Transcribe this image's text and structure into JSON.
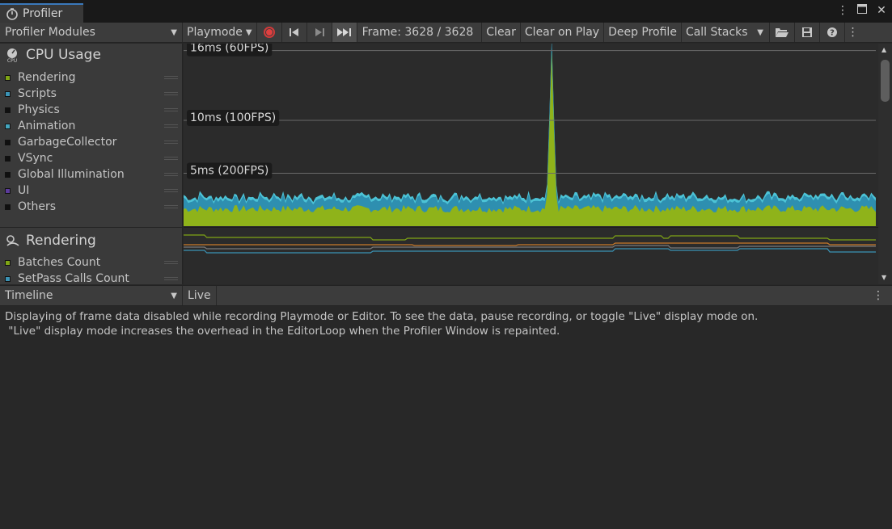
{
  "window": {
    "tab_title": "Profiler",
    "icons": [
      "kebab-menu-icon",
      "maximize-icon",
      "close-icon"
    ]
  },
  "toolbar": {
    "modules_label": "Profiler Modules",
    "target_label": "Playmode",
    "frame_text": "Frame: 3628 / 3628",
    "clear_label": "Clear",
    "clear_on_play_label": "Clear on Play",
    "deep_profile_label": "Deep Profile",
    "call_stacks_label": "Call Stacks",
    "record_color": "#e04040"
  },
  "cpu_module": {
    "title": "CPU Usage",
    "legend": [
      {
        "label": "Rendering",
        "color": "#7fa515"
      },
      {
        "label": "Scripts",
        "color": "#3b93b5"
      },
      {
        "label": "Physics",
        "color": "#101010"
      },
      {
        "label": "Animation",
        "color": "#44a6bf"
      },
      {
        "label": "GarbageCollector",
        "color": "#101010"
      },
      {
        "label": "VSync",
        "color": "#101010"
      },
      {
        "label": "Global Illumination",
        "color": "#101010"
      },
      {
        "label": "UI",
        "color": "#5c3b9c"
      },
      {
        "label": "Others",
        "color": "#101010"
      }
    ]
  },
  "rendering_module": {
    "title": "Rendering",
    "legend": [
      {
        "label": "Batches Count",
        "color": "#7fa515"
      },
      {
        "label": "SetPass Calls Count",
        "color": "#3b93b5"
      }
    ]
  },
  "chart_data": {
    "type": "area",
    "title": "CPU Usage",
    "ylabel": "ms",
    "markers": [
      {
        "label": "16ms (60FPS)",
        "value": 16.6
      },
      {
        "label": "10ms (100FPS)",
        "value": 10
      },
      {
        "label": "5ms (200FPS)",
        "value": 5
      }
    ],
    "ylim": [
      0,
      17
    ],
    "series": [
      {
        "name": "Rendering",
        "color": "#8fb31a",
        "typical": 1.6,
        "spike_frame_fraction": 0.53,
        "spike_value": 16.5
      },
      {
        "name": "Scripts",
        "color": "#2e8fb0",
        "typical": 0.9
      },
      {
        "name": "Animation",
        "color": "#4cc3d6",
        "typical": 0.25
      }
    ]
  },
  "bottom": {
    "view_label": "Timeline",
    "live_label": "Live",
    "message_line1": "Displaying of frame data disabled while recording Playmode or Editor. To see the data, pause recording, or toggle \"Live\" display mode on.",
    "message_line2": " \"Live\" display mode increases the overhead in the EditorLoop when the Profiler Window is repainted."
  }
}
